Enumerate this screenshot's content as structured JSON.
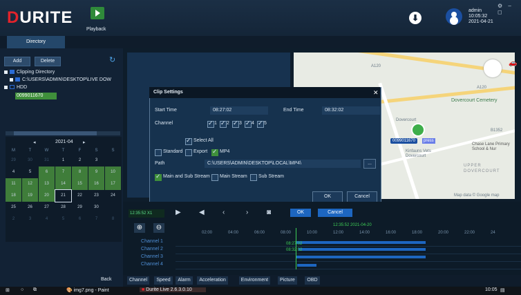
{
  "brand": {
    "logo_prefix": "D",
    "logo_rest": "URITE",
    "accent": "#e2232b"
  },
  "header": {
    "playback_label": "Playback",
    "user": "admin",
    "time": "10:05:32",
    "date": "2021-04-21",
    "window_controls": "⚙ – ◻"
  },
  "tabs": {
    "directory": "Directory"
  },
  "sidebar": {
    "add_label": "Add",
    "delete_label": "Delete",
    "tree": {
      "clipping": "Clipping Directory",
      "clip_path": "C:\\USERS\\ADMIN\\DESKTOP\\LIVE DOW",
      "hdd": "HDD",
      "device": "0099011670"
    },
    "calendar": {
      "month": "2021-04",
      "prev": "◂",
      "next": "▸",
      "headers": [
        "M",
        "T",
        "W",
        "T",
        "F",
        "S",
        "S"
      ],
      "rows": [
        [
          "29",
          "30",
          "31",
          "1",
          "2",
          "3",
          ""
        ],
        [
          "4",
          "5",
          "6",
          "7",
          "8",
          "9",
          "10"
        ],
        [
          "11",
          "12",
          "13",
          "14",
          "15",
          "16",
          "17"
        ],
        [
          "18",
          "19",
          "20",
          "21",
          "22",
          "23",
          "24"
        ],
        [
          "25",
          "26",
          "27",
          "28",
          "29",
          "30",
          ""
        ],
        [
          "2",
          "3",
          "4",
          "5",
          "6",
          "7",
          "8"
        ]
      ]
    },
    "back_label": "Back"
  },
  "map": {
    "road1": "A120",
    "road2": "A120",
    "place1": "Dovercourt Cemetery",
    "place2": "Chase Lane Primary School & Nur",
    "place3": "Kinfauns Vets Dovercourt",
    "place4": "UPPER DOVERCOURT",
    "place5": "Dovercourt",
    "road3": "B1352",
    "attribution": "Map data © Google map",
    "vehicle_id": "0099011670",
    "vehicle_suffix": "press"
  },
  "dialog": {
    "title": "Clip Settings",
    "close": "✕",
    "start_time_label": "Start Time",
    "start_time": "08:27:02",
    "end_time_label": "End Time",
    "end_time": "08:32:02",
    "channel_label": "Channel",
    "channels": [
      "1",
      "2",
      "3",
      "4",
      "5"
    ],
    "select_all": "Select All",
    "standard": "Standard",
    "export": "Export",
    "mp4": "MP4",
    "path_label": "Path",
    "path": "C:\\USERS\\ADMIN\\DESKTOP\\LOCAL\\MP4\\",
    "browse": "...",
    "stream_main_sub": "Main and Sub Stream",
    "stream_main": "Main Stream",
    "stream_sub": "Sub Stream",
    "ok": "OK",
    "cancel": "Cancel"
  },
  "timeline": {
    "current": "12:35:52 X1",
    "ok": "OK",
    "cancel": "Cancel",
    "cursor_time": "12:35:52 2021-04-20",
    "clip_start": "08:27:02",
    "clip_end": "08:32:02",
    "ticks": [
      "02:00",
      "04:00",
      "06:00",
      "08:00",
      "10:00",
      "12:00",
      "14:00",
      "16:00",
      "18:00",
      "20:00",
      "22:00",
      "24"
    ],
    "channels": [
      "Channel 1",
      "Channel 2",
      "Channel 3",
      "Channel 4"
    ]
  },
  "bottom_tabs": [
    "Channel",
    "Speed",
    "Alarm",
    "Acceleration",
    "Environment",
    "Picture",
    "OBD"
  ],
  "taskbar": {
    "app1": "img7.png - Paint",
    "app2": "Durite Live 2.6.3.0.10",
    "clock": "10:05"
  }
}
